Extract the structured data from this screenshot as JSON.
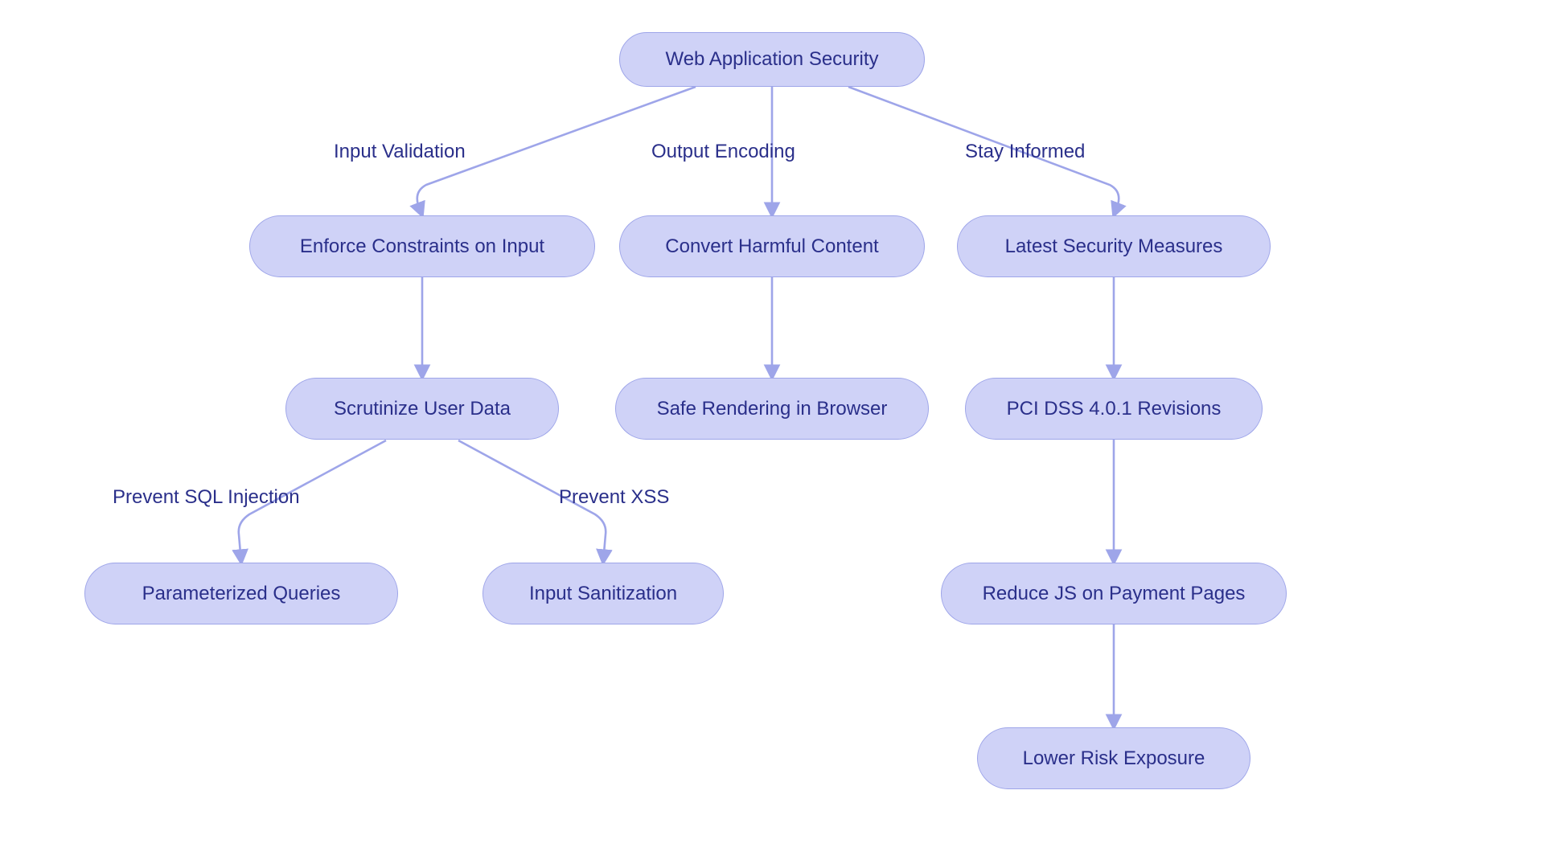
{
  "colors": {
    "node_fill": "#cfd2f7",
    "node_stroke": "#9ea5e9",
    "text": "#2a2f8a",
    "line": "#9ea5e9"
  },
  "nodes": {
    "root": "Web Application Security",
    "iv_enforce": "Enforce Constraints on Input",
    "iv_scrut": "Scrutinize User Data",
    "iv_param": "Parameterized Queries",
    "iv_san": "Input Sanitization",
    "oe_convert": "Convert Harmful Content",
    "oe_safe": "Safe Rendering in Browser",
    "si_latest": "Latest Security Measures",
    "si_pci": "PCI DSS 4.0.1 Revisions",
    "si_js": "Reduce JS on Payment Pages",
    "si_risk": "Lower Risk Exposure"
  },
  "edges": {
    "input_validation": "Input Validation",
    "output_encoding": "Output Encoding",
    "stay_informed": "Stay Informed",
    "prevent_sql": "Prevent SQL Injection",
    "prevent_xss": "Prevent XSS"
  }
}
